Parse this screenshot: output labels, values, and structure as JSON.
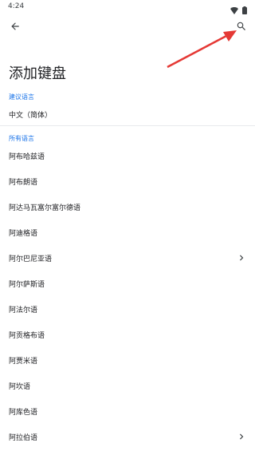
{
  "status_bar": {
    "time": "4:24"
  },
  "header": {
    "back_icon": "arrow-left-icon",
    "search_icon": "search-icon",
    "title": "添加键盘"
  },
  "suggested": {
    "label": "建议语言",
    "items": [
      {
        "label": "中文（简体）"
      }
    ]
  },
  "all_languages": {
    "label": "所有语言",
    "items": [
      {
        "label": "阿布哈兹语"
      },
      {
        "label": "阿布朗语"
      },
      {
        "label": "阿达马瓦富尔富尔德语"
      },
      {
        "label": "阿迪格语"
      },
      {
        "label": "阿尔巴尼亚语"
      },
      {
        "label": "阿尔萨斯语"
      },
      {
        "label": "阿法尔语"
      },
      {
        "label": "阿贡格布语"
      },
      {
        "label": "阿贾米语"
      },
      {
        "label": "阿坎语"
      },
      {
        "label": "阿库色语"
      },
      {
        "label": "阿拉伯语"
      }
    ]
  },
  "colors": {
    "accent": "#1a73e8",
    "annotation": "#e53935"
  }
}
